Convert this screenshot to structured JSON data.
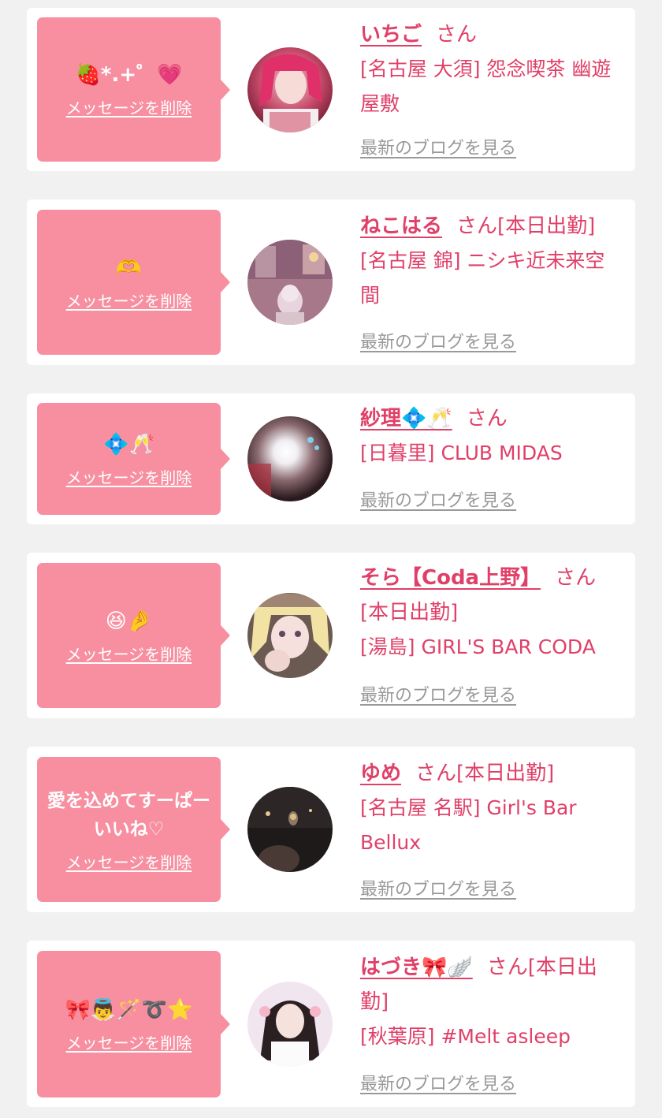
{
  "common": {
    "delete_label": "メッセージを削除",
    "blog_label": "最新のブログを見る",
    "san_label": "さん"
  },
  "colors": {
    "page_bg": "#f1f1f1",
    "card_bg": "#ffffff",
    "bubble_bg": "#f78fa1",
    "accent_text": "#e04068",
    "muted_text": "#999999"
  },
  "cards": [
    {
      "message": "🍓*.+゜💗",
      "name": "いちご",
      "status": "",
      "shop": "[名古屋 大須] 怨念喫茶 幽遊屋敷"
    },
    {
      "message": "🫶",
      "name": "ねこはる",
      "status": "[本日出勤]",
      "shop": "[名古屋 錦] ニシキ近未来空間"
    },
    {
      "message": "💠🥂",
      "name": "紗理💠🥂",
      "status": "",
      "shop": "[日暮里] CLUB MIDAS"
    },
    {
      "message": "😆🤌",
      "name": "そら【Coda上野】",
      "status": "[本日出勤]",
      "shop": "[湯島] GIRL'S BAR CODA"
    },
    {
      "message": "愛を込めてすーぱーいいね♡",
      "name": "ゆめ",
      "status": "[本日出勤]",
      "shop": "[名古屋 名駅] Girl's Bar Bellux"
    },
    {
      "message": "🎀👼🪄➰⭐",
      "name": "はづき🎀🪽",
      "status": "[本日出勤]",
      "shop": "[秋葉原] #Melt asleep"
    }
  ]
}
